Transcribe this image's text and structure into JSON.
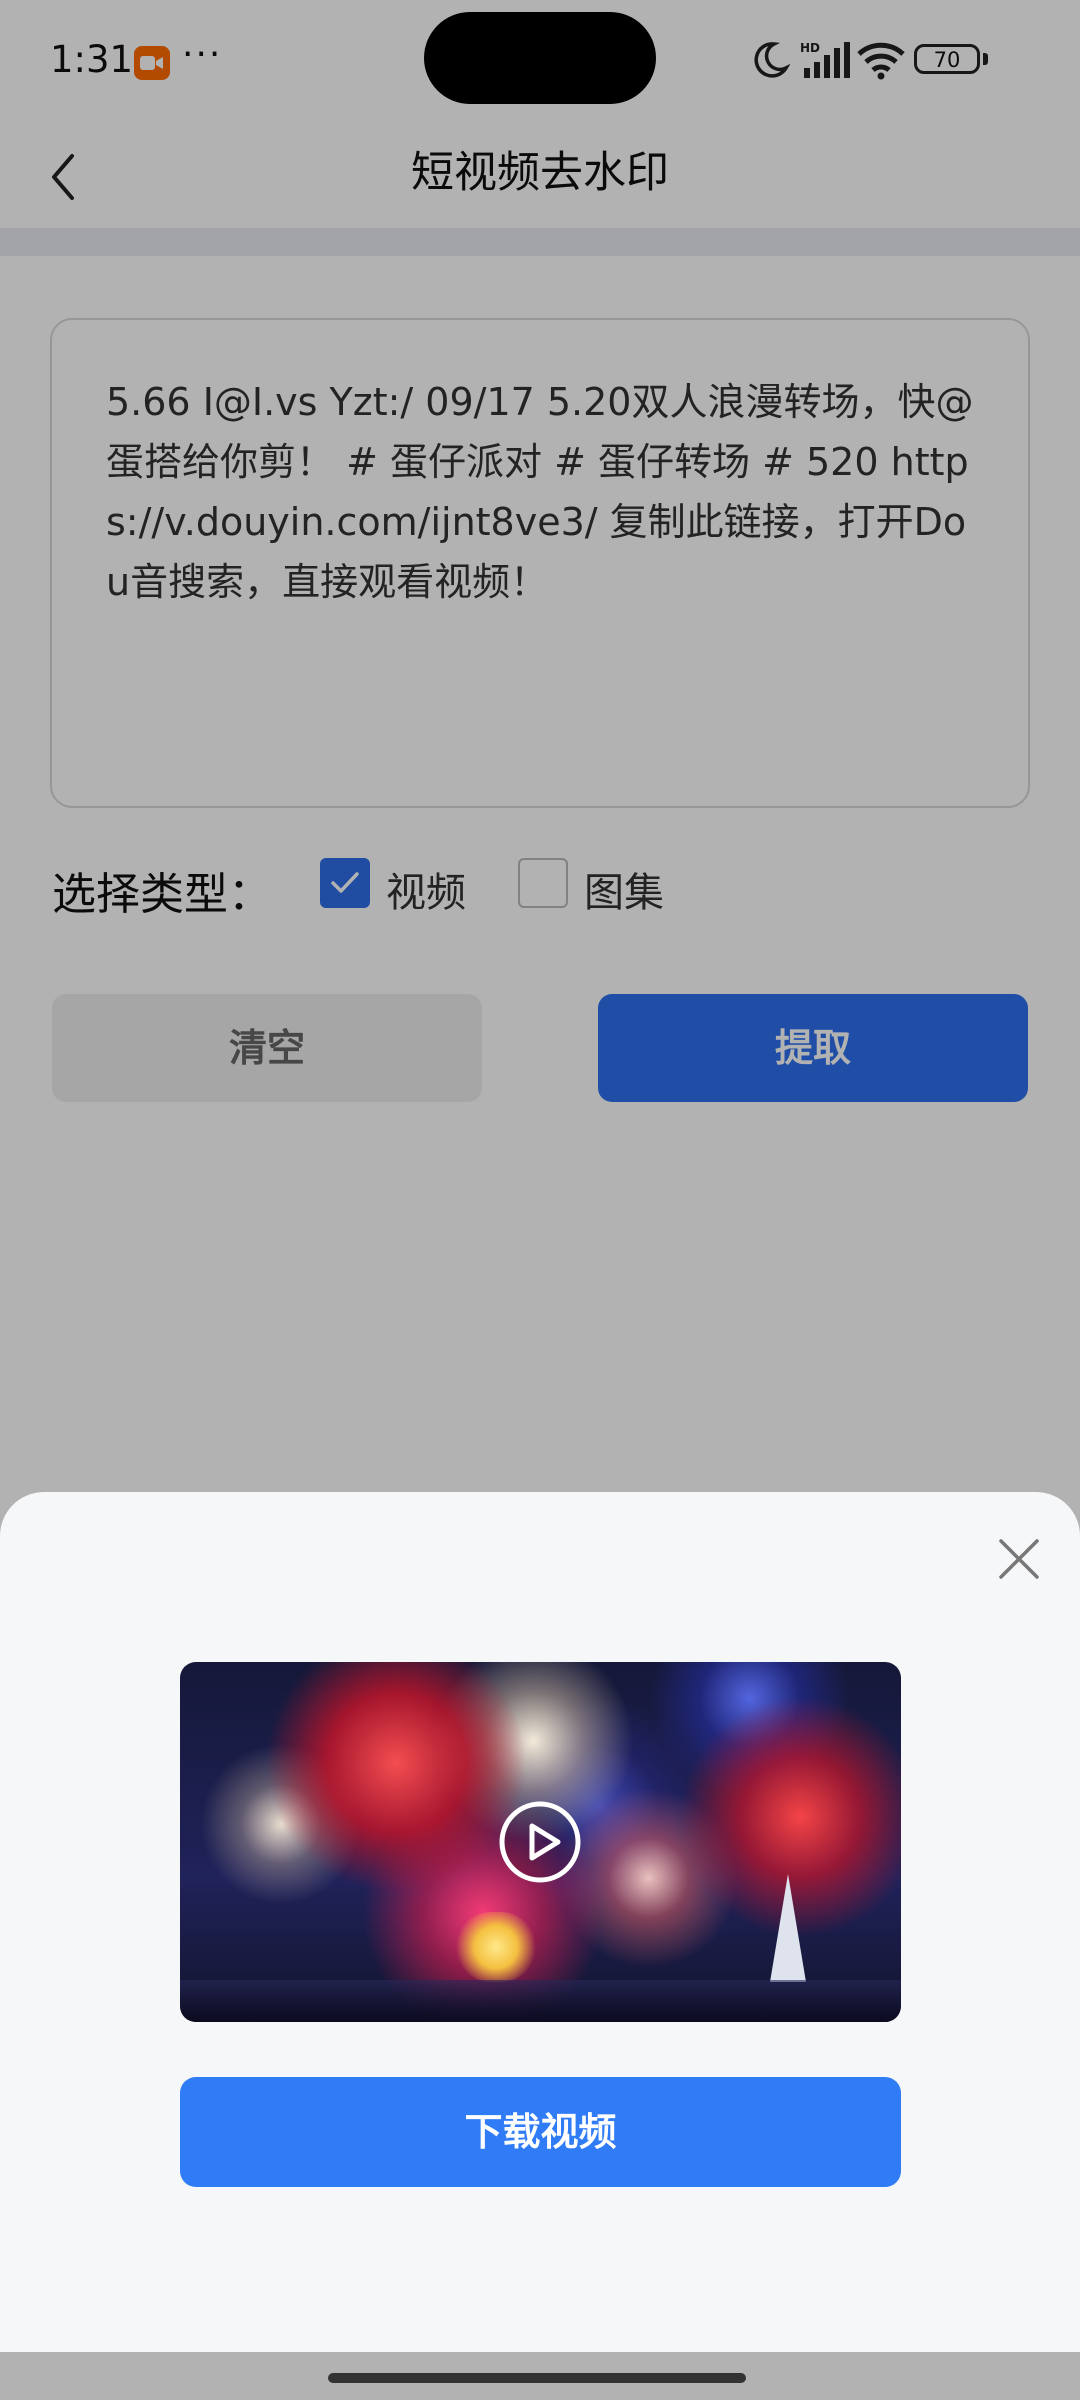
{
  "status_bar": {
    "time": "1:31",
    "more": "···",
    "battery": "70",
    "icons": [
      "screen-record-icon",
      "moon-icon",
      "signal-icon",
      "wifi-icon",
      "battery-icon"
    ]
  },
  "header": {
    "title": "短视频去水印",
    "back_icon": "chevron-left-icon"
  },
  "input": {
    "value": "5.66 I@I.vs Yzt:/ 09/17 5.20双人浪漫转场，快@蛋搭给你剪！ # 蛋仔派对 # 蛋仔转场 # 520  https://v.douyin.com/ijnt8ve3/ 复制此链接，打开Dou音搜索，直接观看视频！"
  },
  "type_select": {
    "label": "选择类型：",
    "options": [
      {
        "label": "视频",
        "checked": true
      },
      {
        "label": "图集",
        "checked": false
      }
    ]
  },
  "actions": {
    "clear": "清空",
    "extract": "提取"
  },
  "sheet": {
    "close_icon": "close-icon",
    "play_icon": "play-circle-icon",
    "download": "下载视频"
  },
  "colors": {
    "primary": "#2f70ef",
    "download": "#2f7cf6",
    "record": "#ff6a00"
  }
}
